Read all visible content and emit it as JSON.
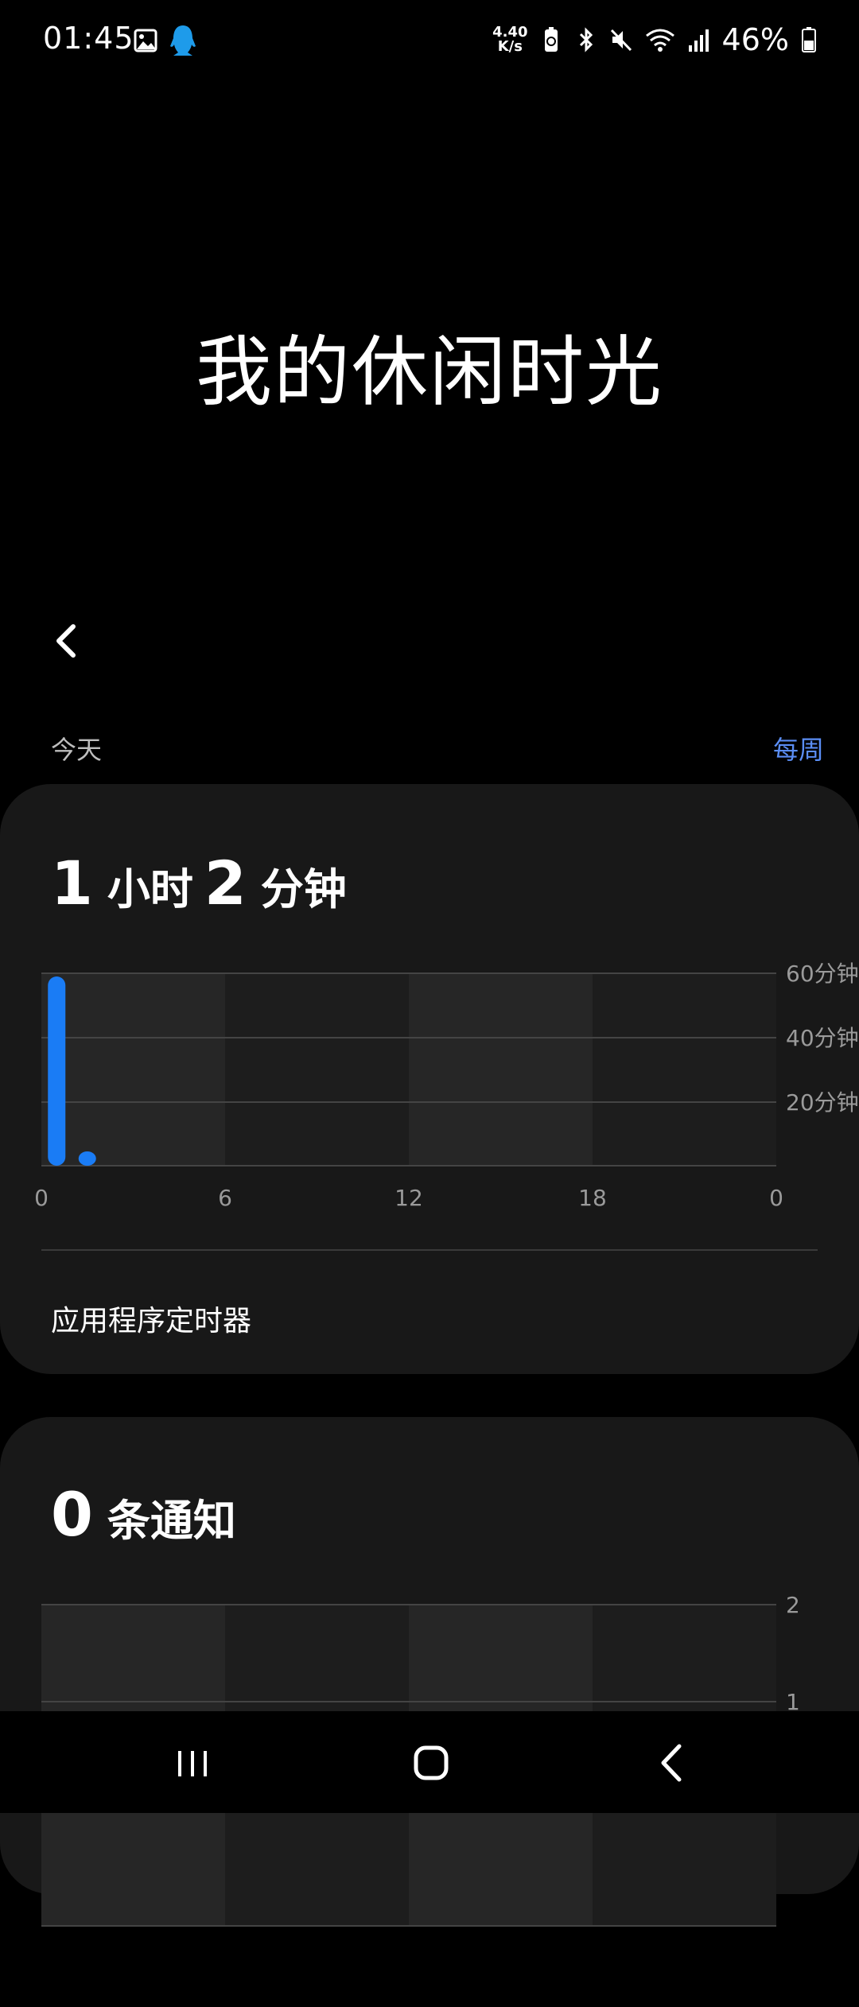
{
  "status_bar": {
    "time": "01:45",
    "speed_value": "4.40",
    "speed_unit": "K/s",
    "battery": "46%",
    "icons": [
      "gallery-icon",
      "qq-icon",
      "battery-saver-icon",
      "bluetooth-icon",
      "mute-icon",
      "wifi-icon",
      "signal-icon",
      "battery-icon"
    ]
  },
  "page": {
    "title": "我的休闲时光",
    "period_today": "今天",
    "period_weekly": "每周",
    "accent_color": "#5b8ef5",
    "bar_color": "#1a7cf5"
  },
  "usage_card": {
    "hours": "1",
    "hours_unit": "小时",
    "minutes": "2",
    "minutes_unit": "分钟",
    "app_timer_label": "应用程序定时器"
  },
  "notifications_card": {
    "count": "0",
    "count_unit": "条通知"
  },
  "chart_data": [
    {
      "type": "bar",
      "x_ticks": [
        "0",
        "6",
        "12",
        "18",
        "0"
      ],
      "y_ticks": [
        "60分钟",
        "40分钟",
        "20分钟"
      ],
      "ylim": [
        0,
        60
      ],
      "bars": [
        {
          "hour": 0.5,
          "minutes": 59
        },
        {
          "hour": 1.5,
          "minutes": 3
        }
      ]
    },
    {
      "type": "bar",
      "y_ticks": [
        "2",
        "1"
      ],
      "ylim": [
        0,
        2
      ],
      "bars": []
    }
  ],
  "nav": {
    "icons": [
      "recents-icon",
      "home-icon",
      "back-nav-icon"
    ]
  }
}
